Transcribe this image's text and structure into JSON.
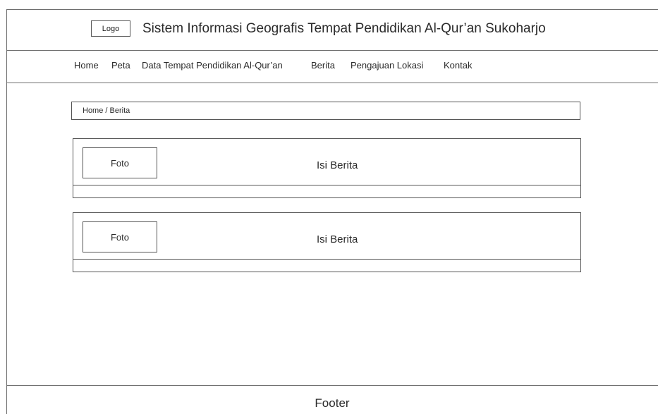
{
  "header": {
    "logo_label": "Logo",
    "title": "Sistem Informasi Geografis Tempat Pendidikan Al-Qur’an Sukoharjo"
  },
  "nav": {
    "items": [
      {
        "label": "Home"
      },
      {
        "label": "Peta"
      },
      {
        "label": "Data Tempat Pendidikan Al-Qur’an"
      },
      {
        "label": "Berita"
      },
      {
        "label": "Pengajuan Lokasi"
      },
      {
        "label": "Kontak"
      }
    ]
  },
  "breadcrumb": {
    "text": "Home / Berita"
  },
  "news": [
    {
      "photo_label": "Foto",
      "content": "Isi Berita"
    },
    {
      "photo_label": "Foto",
      "content": "Isi Berita"
    }
  ],
  "footer": {
    "text": "Footer"
  }
}
